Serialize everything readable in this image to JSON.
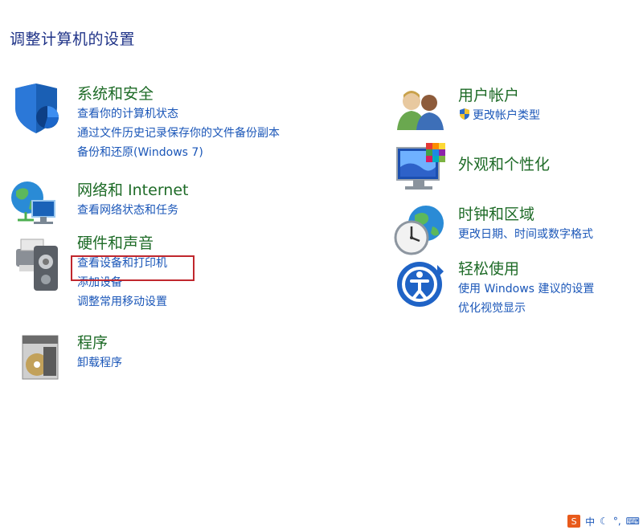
{
  "page": {
    "title": "调整计算机的设置"
  },
  "left": [
    {
      "key": "security",
      "title": "系统和安全",
      "icon": "shield-icon",
      "links": [
        "查看你的计算机状态",
        "通过文件历史记录保存你的文件备份副本",
        "备份和还原(Windows 7)"
      ]
    },
    {
      "key": "network",
      "title": "网络和 Internet",
      "icon": "network-globe-icon",
      "links": [
        "查看网络状态和任务"
      ]
    },
    {
      "key": "hardware",
      "title": "硬件和声音",
      "icon": "printer-speaker-icon",
      "links": [
        "查看设备和打印机",
        "添加设备",
        "调整常用移动设置"
      ]
    },
    {
      "key": "programs",
      "title": "程序",
      "icon": "programs-disc-icon",
      "links": [
        "卸载程序"
      ]
    }
  ],
  "right": [
    {
      "key": "user-accounts",
      "title": "用户帐户",
      "icon": "users-icon",
      "links": [
        "更改帐户类型"
      ],
      "link_icon": "uac-shield-icon"
    },
    {
      "key": "appearance",
      "title": "外观和个性化",
      "icon": "monitor-palette-icon",
      "links": []
    },
    {
      "key": "clock-region",
      "title": "时钟和区域",
      "icon": "clock-globe-icon",
      "links": [
        "更改日期、时间或数字格式"
      ]
    },
    {
      "key": "ease-of-access",
      "title": "轻松使用",
      "icon": "ease-of-access-icon",
      "links": [
        "使用 Windows 建议的设置",
        "优化视觉显示"
      ]
    }
  ],
  "highlight": {
    "target": "查看设备和打印机",
    "color": "#c0272d"
  },
  "tray": {
    "ime_logo": "S",
    "ime_mode": "中",
    "icons": [
      "moon-icon",
      "punctuation-icon",
      "keyboard-icon"
    ]
  },
  "colors": {
    "title": "#1e3287",
    "category": "#1e6b27",
    "link": "#1a56b8"
  }
}
